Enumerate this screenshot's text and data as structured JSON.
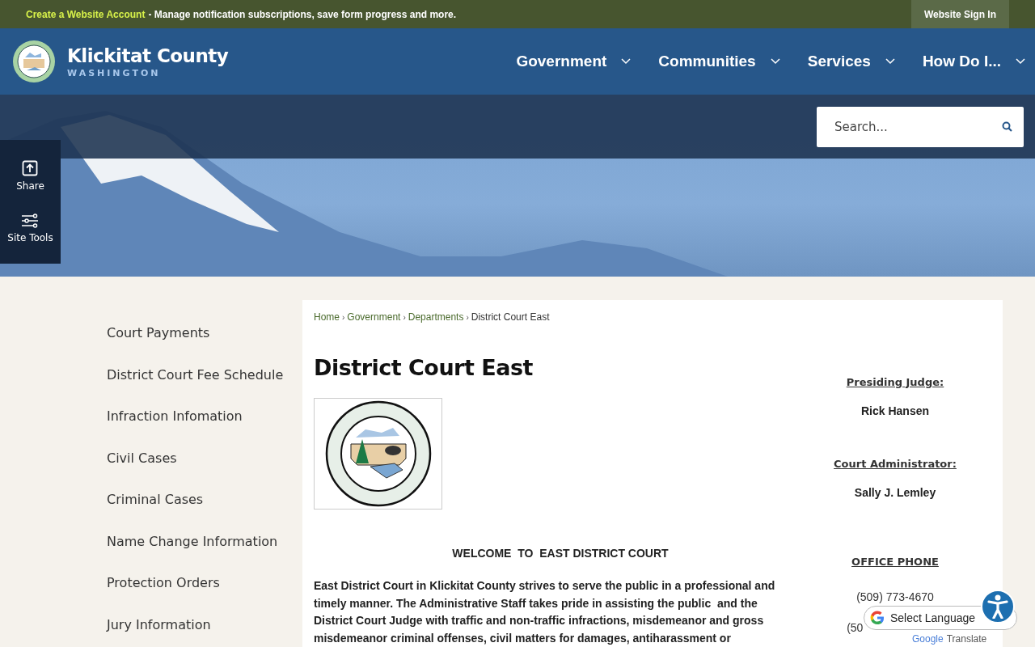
{
  "top_bar": {
    "link": "Create a Website Account",
    "text": "- Manage notification subscriptions, save form progress and more.",
    "sign_in": "Website Sign In"
  },
  "header": {
    "title": "Klickitat County",
    "subtitle": "WASHINGTON",
    "nav": [
      {
        "label": "Government"
      },
      {
        "label": "Communities"
      },
      {
        "label": "Services"
      },
      {
        "label": "How Do I..."
      }
    ]
  },
  "search": {
    "placeholder": "Search..."
  },
  "side_tools": [
    {
      "kind": "share",
      "label": "Share"
    },
    {
      "kind": "tools",
      "label": "Site Tools"
    }
  ],
  "sidebar": {
    "items": [
      "Court Payments",
      "District Court Fee Schedule",
      "Infraction Infomation",
      "Civil Cases",
      "Criminal Cases",
      "Name Change Information",
      "Protection Orders",
      "Jury Information"
    ]
  },
  "breadcrumb": [
    "Home",
    "Government",
    "Departments",
    "District Court East"
  ],
  "breadcrumb_separator": "›",
  "page_title": "District Court East",
  "welcome": "WELCOME  TO  EAST DISTRICT COURT",
  "paragraph": "East District Court in Klickitat County strives to serve the public in a professional and timely manner. The Administrative Staff takes pride in assisting the public  and the District Court Judge with traffic and non-traffic infractions, misdemeanor and gross misdemeanor criminal offenses, civil matters for damages, antiharassment or",
  "contacts": [
    {
      "heading": "Presiding Judge:",
      "value": "Rick Hansen"
    },
    {
      "heading": "Court Administrator:",
      "value": "Sally J. Lemley"
    }
  ],
  "phone": {
    "heading": "OFFICE PHONE",
    "numbers": [
      "(509) 773-4670",
      "(50"
    ]
  },
  "translate": {
    "label": "Select Language",
    "brand": "Google",
    "powered": "Translate"
  }
}
